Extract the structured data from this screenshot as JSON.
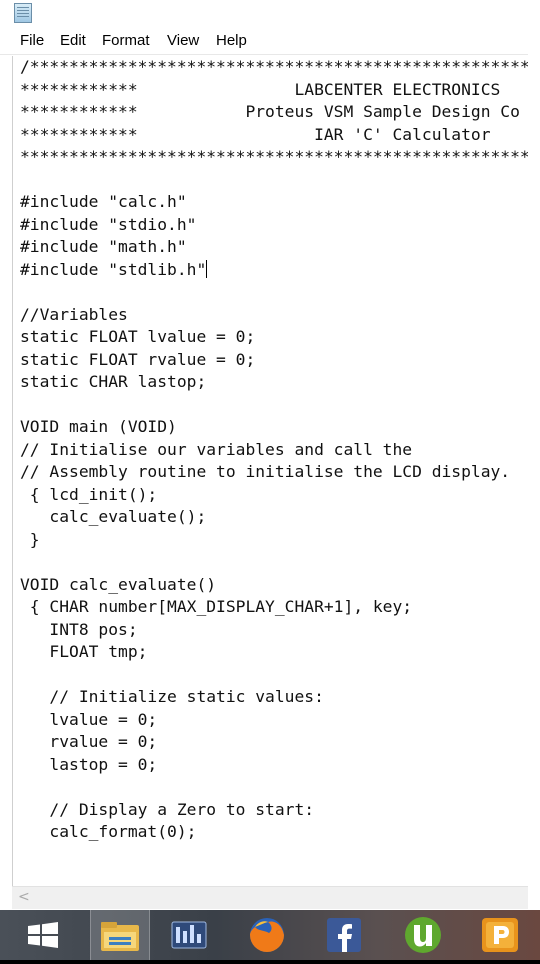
{
  "window": {
    "menu": [
      "File",
      "Edit",
      "Format",
      "View",
      "Help"
    ]
  },
  "editor": {
    "lines": [
      "/*******************************************************",
      "************                LABCENTER ELECTRONICS",
      "************           Proteus VSM Sample Design Co",
      "************                  IAR 'C' Calculator",
      "*******************************************************",
      "",
      "#include \"calc.h\"",
      "#include \"stdio.h\"",
      "#include \"math.h\"",
      "#include \"stdlib.h\"",
      "",
      "//Variables",
      "static FLOAT lvalue = 0;",
      "static FLOAT rvalue = 0;",
      "static CHAR lastop;",
      "",
      "VOID main (VOID)",
      "// Initialise our variables and call the",
      "// Assembly routine to initialise the LCD display.",
      " { lcd_init();",
      "   calc_evaluate();",
      " }",
      "",
      "VOID calc_evaluate()",
      " { CHAR number[MAX_DISPLAY_CHAR+1], key;",
      "   INT8 pos;",
      "   FLOAT tmp;",
      "",
      "   // Initialize static values:",
      "   lvalue = 0;",
      "   rvalue = 0;",
      "   lastop = 0;",
      "",
      "   // Display a Zero to start:",
      "   calc_format(0);"
    ],
    "caret_line": 9
  },
  "scrollbar": {
    "left_arrow": "<"
  },
  "taskbar": {
    "apps": [
      "windows-start",
      "file-explorer",
      "control-panel",
      "firefox",
      "facebook",
      "utorrent",
      "powerpoint"
    ]
  }
}
